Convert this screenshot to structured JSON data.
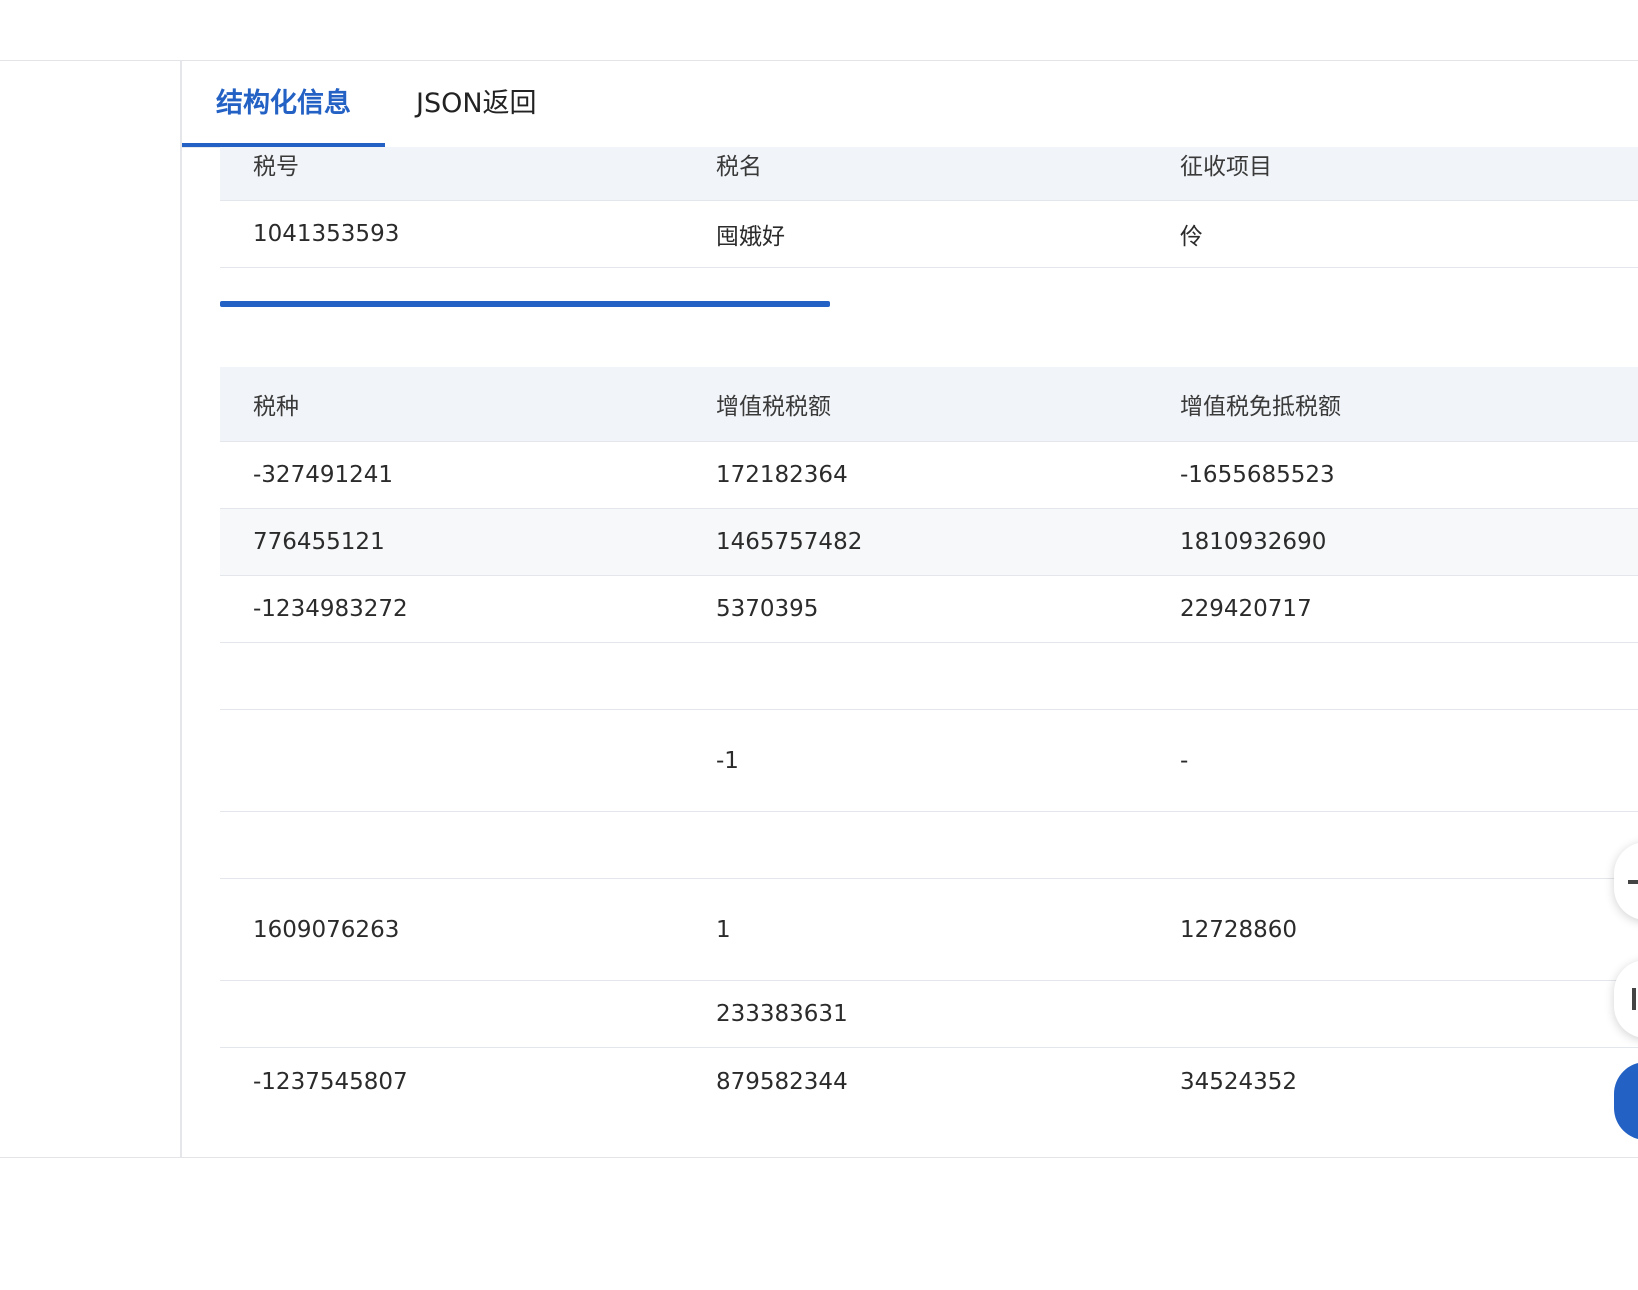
{
  "tabs": [
    {
      "label": "结构化信息",
      "active": true
    },
    {
      "label": "JSON返回",
      "active": false
    }
  ],
  "top_table": {
    "headers": [
      "税号",
      "税名",
      "征收项目"
    ],
    "rows": [
      [
        "1041353593",
        "囤娥好",
        "伶"
      ]
    ]
  },
  "progress": {
    "fraction": 0.43,
    "color": "#2361c4"
  },
  "main_table": {
    "headers": [
      "税种",
      "增值税税额",
      "增值税免抵税额"
    ],
    "rows": [
      [
        "-327491241",
        "172182364",
        "-1655685523"
      ],
      [
        "776455121",
        "1465757482",
        "1810932690"
      ],
      [
        "-1234983272",
        "5370395",
        "229420717"
      ],
      [
        "",
        "",
        ""
      ],
      [
        "",
        "-1",
        "-"
      ],
      [
        "",
        "",
        ""
      ],
      [
        "1609076263",
        "1",
        "12728860"
      ],
      [
        "",
        "233383631",
        ""
      ],
      [
        "-1237545807",
        "879582344",
        "34524352"
      ]
    ]
  },
  "colors": {
    "accent": "#2361c4",
    "header_bg": "#f1f4f8",
    "alt_row_bg": "#f7f8fa"
  },
  "float_buttons": [
    {
      "icon": "chevron-up-icon"
    },
    {
      "icon": "doc-icon"
    },
    {
      "icon": "chat-icon"
    }
  ]
}
